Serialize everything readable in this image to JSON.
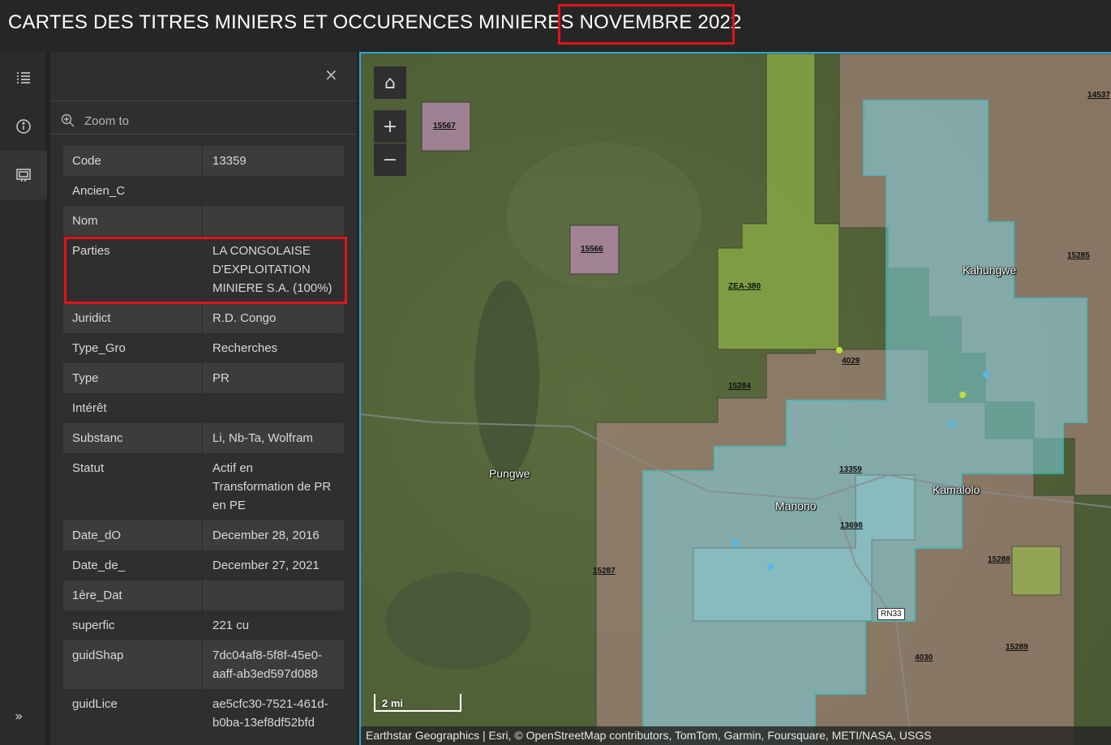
{
  "header": {
    "title_prefix": "CARTES DES TITRES MINIERS ET OCCURENCES MINIERES ",
    "title_highlight": "NOVEMBRE 2022"
  },
  "sidebar": {
    "icons": [
      "layers-list-icon",
      "info-icon",
      "popup-feature-icon"
    ],
    "expand": "»"
  },
  "panel": {
    "close": "×",
    "zoom_to": "Zoom to",
    "attributes": [
      {
        "key": "Code",
        "value": "13359"
      },
      {
        "key": "Ancien_C",
        "value": ""
      },
      {
        "key": "Nom",
        "value": ""
      },
      {
        "key": "Parties",
        "value": "LA CONGOLAISE D'EXPLOITATION MINIERE S.A. (100%)"
      },
      {
        "key": "Juridict",
        "value": "R.D. Congo"
      },
      {
        "key": "Type_Gro",
        "value": "Recherches"
      },
      {
        "key": "Type",
        "value": "PR"
      },
      {
        "key": "Intérêt",
        "value": ""
      },
      {
        "key": "Substanc",
        "value": "Li, Nb-Ta, Wolfram"
      },
      {
        "key": "Statut",
        "value": "Actif en Transformation de PR en PE"
      },
      {
        "key": "Date_dO",
        "value": "December 28, 2016"
      },
      {
        "key": "Date_de_",
        "value": "December 27, 2021"
      },
      {
        "key": "1ère_Dat",
        "value": ""
      },
      {
        "key": "superfic",
        "value": "221 cu"
      },
      {
        "key": "guidShap",
        "value": "7dc04af8-5f8f-45e0-aaff-ab3ed597d088"
      },
      {
        "key": "guidLice",
        "value": "ae5cfc30-7521-461d-b0ba-13ef8df52bfd"
      }
    ]
  },
  "map": {
    "controls": {
      "home": "⌂",
      "zoom_in": "+",
      "zoom_out": "−"
    },
    "parcel_labels": [
      "15567",
      "15566",
      "ZEA-380",
      "4029",
      "15284",
      "13359",
      "13698",
      "15287",
      "15288",
      "15289",
      "4030",
      "15285",
      "14537"
    ],
    "towns": [
      "Pungwe",
      "Kahungwe",
      "Manono",
      "Kamalolo"
    ],
    "road_label": "RN33",
    "scale": "2 mi",
    "attribution": "Earthstar Geographics | Esri, © OpenStreetMap contributors, TomTom, Garmin, Foursquare, METI/NASA, USGS"
  }
}
